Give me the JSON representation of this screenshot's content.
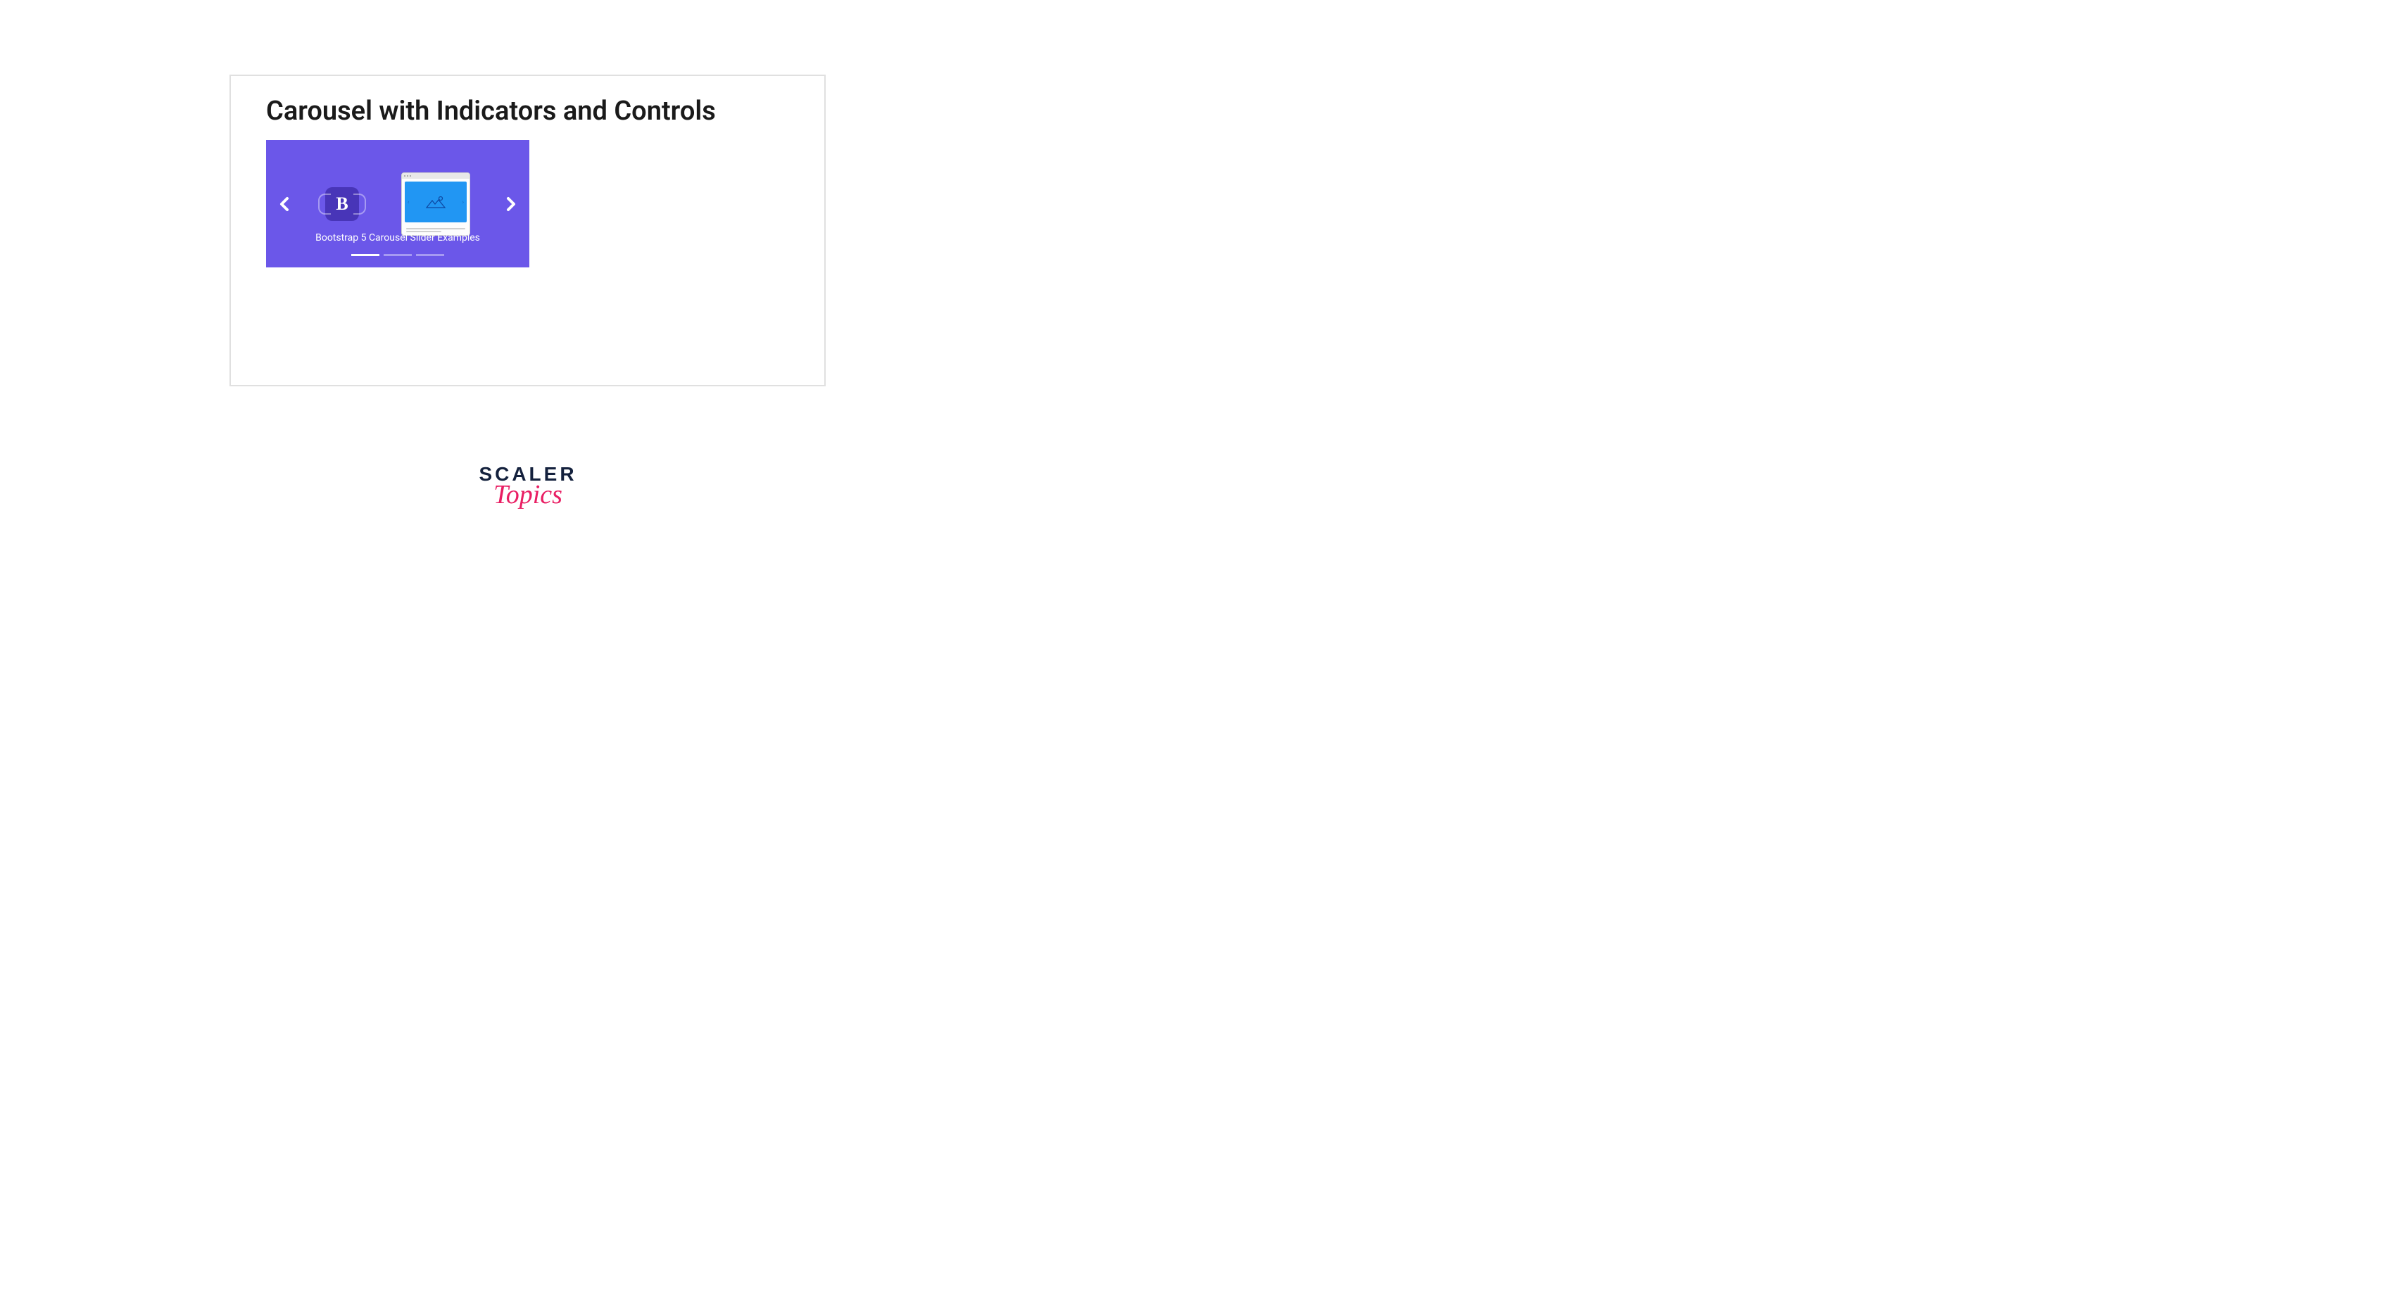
{
  "heading": "Carousel with Indicators and Controls",
  "carousel": {
    "caption": "Bootstrap 5 Carousel Slider Examples",
    "bootstrap_letter": "B",
    "active_indicator": 0,
    "indicator_count": 3
  },
  "brand": {
    "top": "SCALER",
    "bottom": "Topics"
  }
}
